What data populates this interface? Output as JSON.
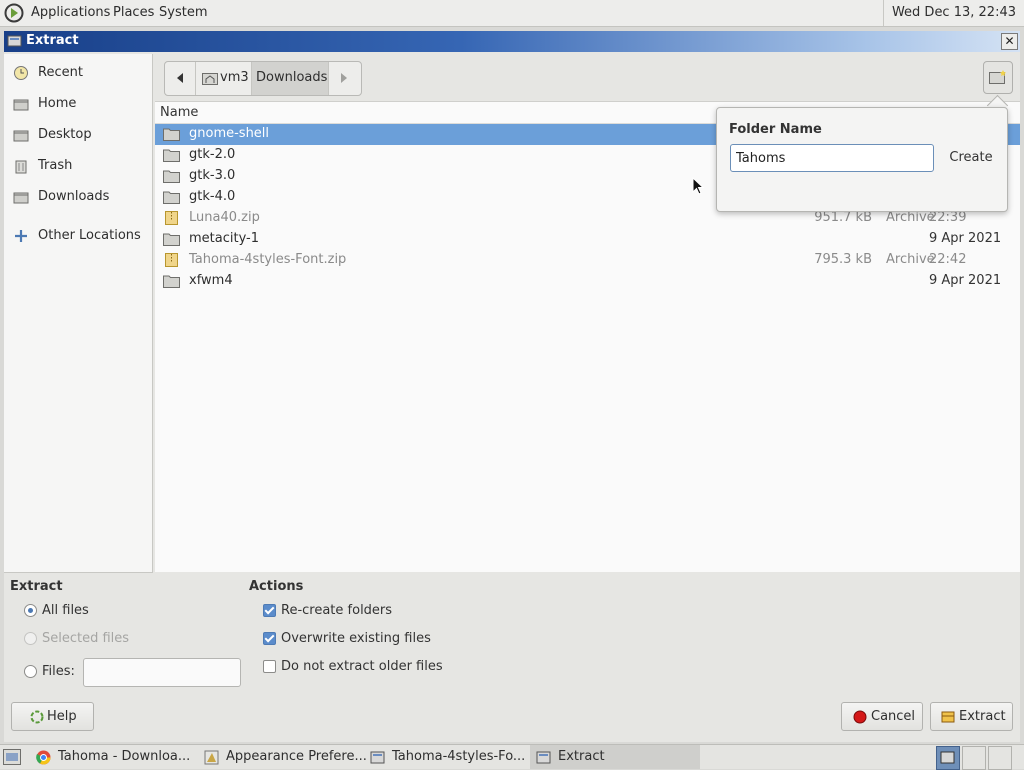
{
  "top_panel": {
    "menus": [
      "Applications",
      "Places",
      "System"
    ],
    "clock": "Wed Dec 13, 22:43"
  },
  "window": {
    "title": "Extract"
  },
  "sidebar": {
    "items": [
      {
        "label": "Recent",
        "icon": "clock-icon"
      },
      {
        "label": "Home",
        "icon": "home-icon"
      },
      {
        "label": "Desktop",
        "icon": "desktop-icon"
      },
      {
        "label": "Trash",
        "icon": "trash-icon"
      },
      {
        "label": "Downloads",
        "icon": "downloads-icon"
      },
      {
        "label": "Other Locations",
        "icon": "plus-icon"
      }
    ]
  },
  "pathbar": {
    "segments": [
      "vm3",
      "Downloads"
    ]
  },
  "filelist": {
    "columns": {
      "name": "Name"
    },
    "rows": [
      {
        "name": "gnome-shell",
        "size": "",
        "type": "",
        "modified": "",
        "selected": true
      },
      {
        "name": "gtk-2.0",
        "size": "",
        "type": "",
        "modified": ""
      },
      {
        "name": "gtk-3.0",
        "size": "",
        "type": "",
        "modified": ""
      },
      {
        "name": "gtk-4.0",
        "size": "",
        "type": "",
        "modified": ""
      },
      {
        "name": "Luna40.zip",
        "size": "951.7 kB",
        "type": "Archive",
        "modified": "22:39",
        "dim": true
      },
      {
        "name": "metacity-1",
        "size": "",
        "type": "",
        "modified": "9 Apr 2021"
      },
      {
        "name": "Tahoma-4styles-Font.zip",
        "size": "795.3 kB",
        "type": "Archive",
        "modified": "22:42",
        "dim": true
      },
      {
        "name": "xfwm4",
        "size": "",
        "type": "",
        "modified": "9 Apr 2021"
      }
    ]
  },
  "popover": {
    "title": "Folder Name",
    "input_value": "Tahoms",
    "create_label": "Create"
  },
  "extract_section": {
    "title": "Extract",
    "all_files": "All files",
    "selected_files": "Selected files",
    "files": "Files:"
  },
  "actions_section": {
    "title": "Actions",
    "recreate_folders": "Re-create folders",
    "overwrite_existing": "Overwrite existing files",
    "no_extract_older": "Do not extract older files"
  },
  "buttons": {
    "help": "Help",
    "cancel": "Cancel",
    "extract": "Extract"
  },
  "taskbar": {
    "tasks": [
      "Tahoma - Downloa...",
      "Appearance Prefere...",
      "Tahoma-4styles-Fo...",
      "Extract"
    ]
  },
  "colors": {
    "selection": "#6b9fd9",
    "titlebar": "#183f88",
    "accent": "#5b8ccb"
  }
}
